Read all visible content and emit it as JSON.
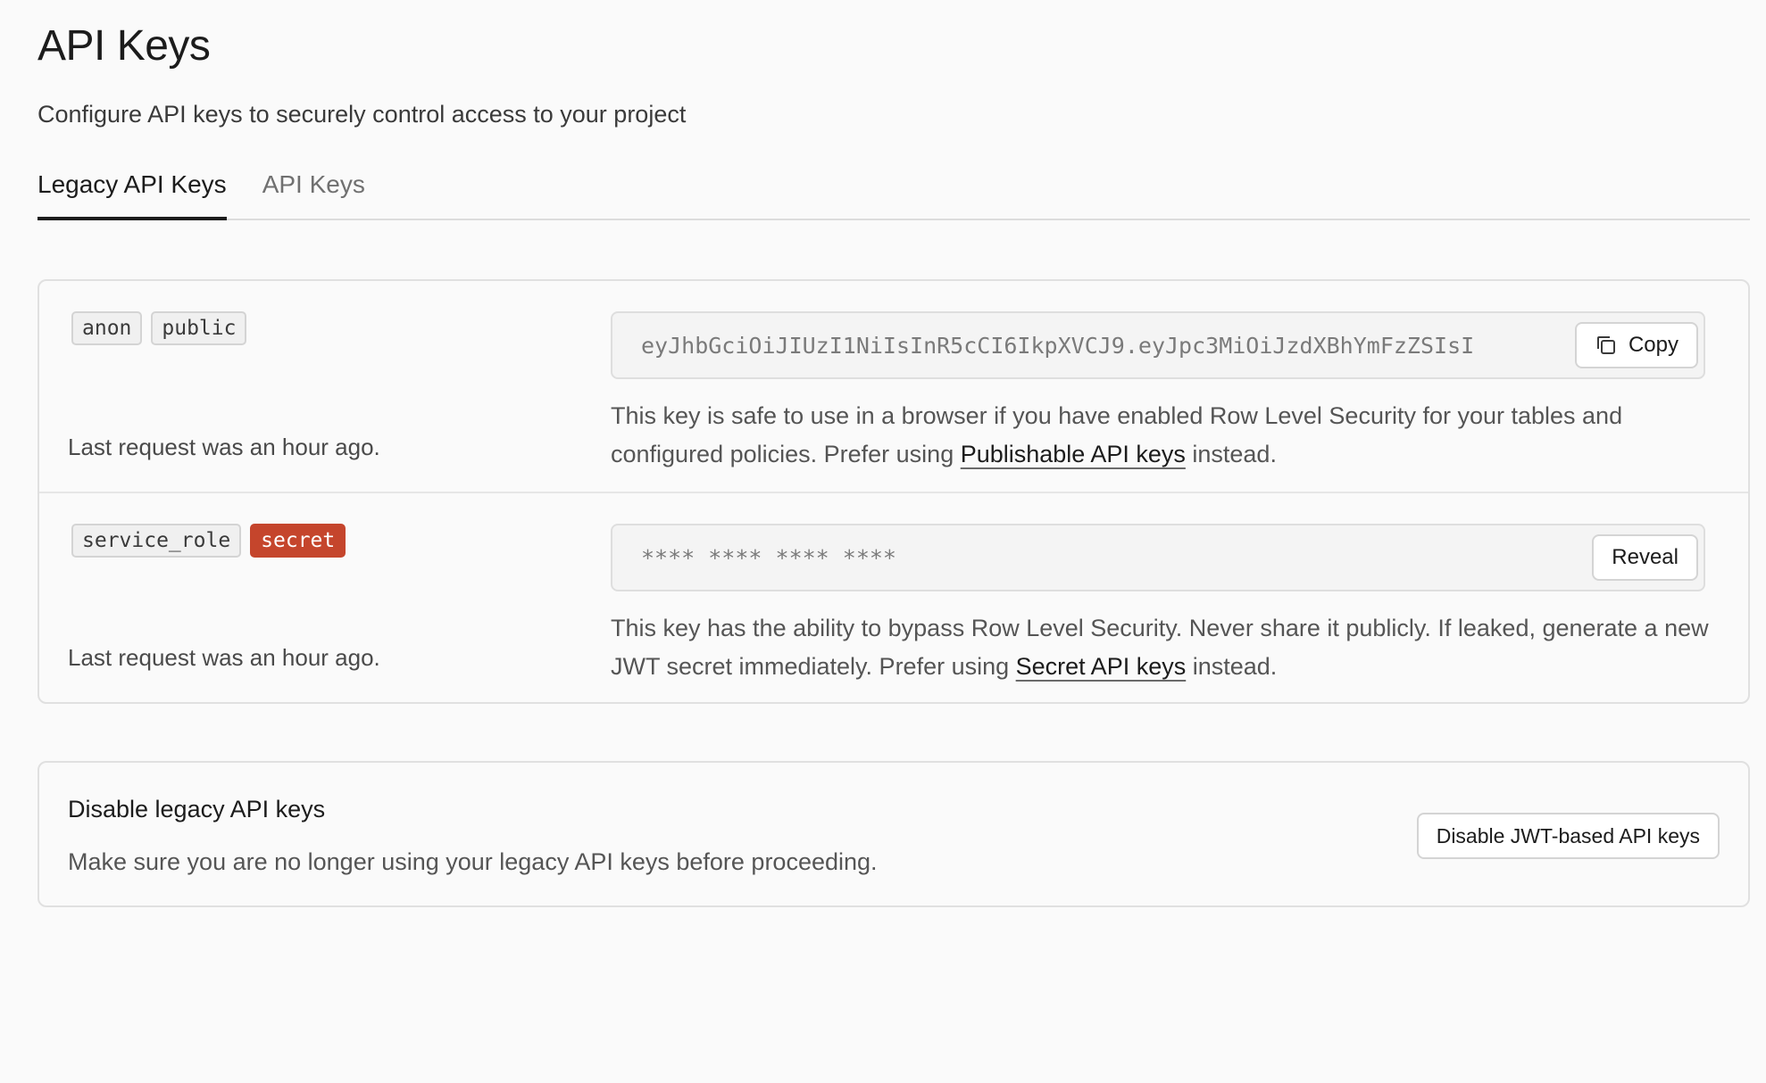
{
  "header": {
    "title": "API Keys",
    "subtitle": "Configure API keys to securely control access to your project"
  },
  "tabs": [
    {
      "label": "Legacy API Keys",
      "active": true
    },
    {
      "label": "API Keys",
      "active": false
    }
  ],
  "keys": [
    {
      "badges": [
        {
          "label": "anon",
          "style": "neutral"
        },
        {
          "label": "public",
          "style": "neutral"
        }
      ],
      "value": "eyJhbGciOiJIUzI1NiIsInR5cCI6IkpXVCJ9.eyJpc3MiOiJzdXBhYmFzZSIsI",
      "button_label": "Copy",
      "button_icon": "copy-icon",
      "desc_before": "This key is safe to use in a browser if you have enabled Row Level Security for your tables and configured policies. Prefer using ",
      "desc_link": "Publishable API keys",
      "desc_after": " instead.",
      "last_request": "Last request was an hour ago."
    },
    {
      "badges": [
        {
          "label": "service_role",
          "style": "neutral"
        },
        {
          "label": "secret",
          "style": "danger"
        }
      ],
      "value": "**** **** **** ****",
      "button_label": "Reveal",
      "desc_before": "This key has the ability to bypass Row Level Security. Never share it publicly. If leaked, generate a new JWT secret immediately. Prefer using ",
      "desc_link": "Secret API keys",
      "desc_after": " instead.",
      "last_request": "Last request was an hour ago."
    }
  ],
  "disable_section": {
    "title": "Disable legacy API keys",
    "description": "Make sure you are no longer using your legacy API keys before proceeding.",
    "button_label": "Disable JWT-based API keys"
  },
  "colors": {
    "danger_badge": "#c5452c",
    "background": "#fafafa",
    "text": "#1c1c1c"
  }
}
